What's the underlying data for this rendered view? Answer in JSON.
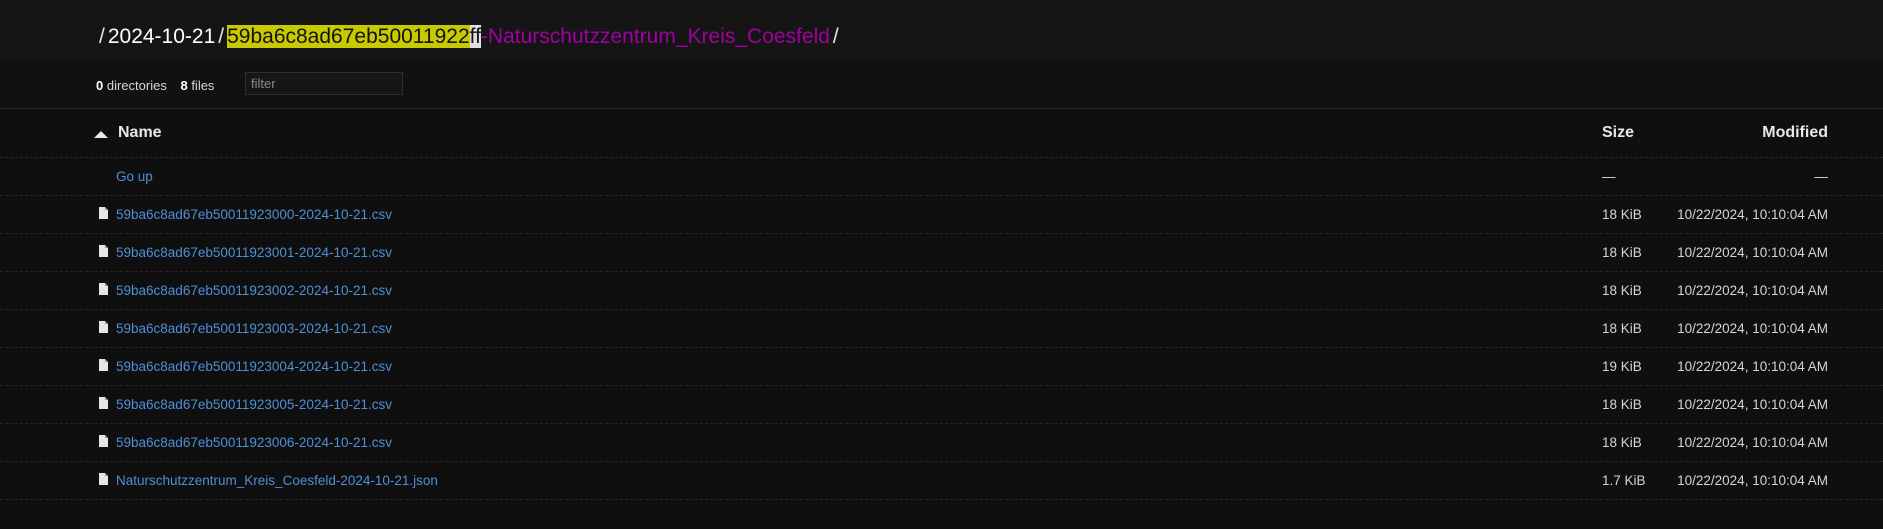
{
  "breadcrumb": {
    "date": "2024-10-21",
    "current_highlight": "59ba6c8ad67eb50011922",
    "current_cursor": "ff",
    "current_rest": "-Naturschutzzentrum_Kreis_Coesfeld"
  },
  "summary": {
    "dir_count": "0",
    "dir_label": "directories",
    "file_count": "8",
    "file_label": "files",
    "filter_placeholder": "filter"
  },
  "table": {
    "headers": {
      "name": "Name",
      "size": "Size",
      "modified": "Modified"
    },
    "go_up": {
      "label": "Go up",
      "size": "—",
      "modified": "—"
    },
    "rows": [
      {
        "name": "59ba6c8ad67eb50011923000-2024-10-21.csv",
        "size": "18 KiB",
        "modified": "10/22/2024, 10:10:04 AM"
      },
      {
        "name": "59ba6c8ad67eb50011923001-2024-10-21.csv",
        "size": "18 KiB",
        "modified": "10/22/2024, 10:10:04 AM"
      },
      {
        "name": "59ba6c8ad67eb50011923002-2024-10-21.csv",
        "size": "18 KiB",
        "modified": "10/22/2024, 10:10:04 AM"
      },
      {
        "name": "59ba6c8ad67eb50011923003-2024-10-21.csv",
        "size": "18 KiB",
        "modified": "10/22/2024, 10:10:04 AM"
      },
      {
        "name": "59ba6c8ad67eb50011923004-2024-10-21.csv",
        "size": "19 KiB",
        "modified": "10/22/2024, 10:10:04 AM"
      },
      {
        "name": "59ba6c8ad67eb50011923005-2024-10-21.csv",
        "size": "18 KiB",
        "modified": "10/22/2024, 10:10:04 AM"
      },
      {
        "name": "59ba6c8ad67eb50011923006-2024-10-21.csv",
        "size": "18 KiB",
        "modified": "10/22/2024, 10:10:04 AM"
      },
      {
        "name": "Naturschutzzentrum_Kreis_Coesfeld-2024-10-21.json",
        "size": "1.7 KiB",
        "modified": "10/22/2024, 10:10:04 AM"
      }
    ]
  },
  "icons": {
    "file": "file-icon",
    "sort": "sort-ascending-icon"
  },
  "colors": {
    "link": "#4f8fd6",
    "highlight": "#c9c900",
    "current_folder": "#a000a0",
    "background": "#0f0f0f"
  }
}
